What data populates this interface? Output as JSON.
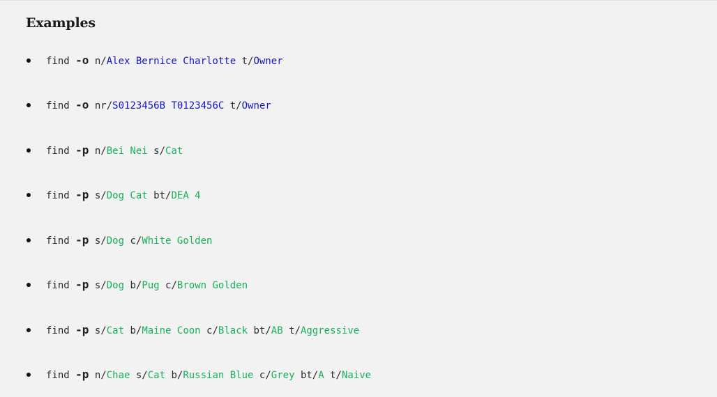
{
  "heading": "Examples",
  "examples": [
    {
      "command": "find",
      "flag": "-o",
      "params": [
        {
          "prefix": "n/",
          "value": "Alex Bernice Charlotte"
        },
        {
          "prefix": "t/",
          "value": "Owner"
        }
      ]
    },
    {
      "command": "find",
      "flag": "-o",
      "params": [
        {
          "prefix": "nr/",
          "value": "S0123456B T0123456C"
        },
        {
          "prefix": "t/",
          "value": "Owner"
        }
      ]
    },
    {
      "command": "find",
      "flag": "-p",
      "params": [
        {
          "prefix": "n/",
          "value": "Bei Nei"
        },
        {
          "prefix": "s/",
          "value": "Cat"
        }
      ]
    },
    {
      "command": "find",
      "flag": "-p",
      "params": [
        {
          "prefix": "s/",
          "value": "Dog Cat"
        },
        {
          "prefix": "bt/",
          "value": "DEA 4"
        }
      ]
    },
    {
      "command": "find",
      "flag": "-p",
      "params": [
        {
          "prefix": "s/",
          "value": "Dog"
        },
        {
          "prefix": "c/",
          "value": "White Golden"
        }
      ]
    },
    {
      "command": "find",
      "flag": "-p",
      "params": [
        {
          "prefix": "s/",
          "value": "Dog"
        },
        {
          "prefix": "b/",
          "value": "Pug"
        },
        {
          "prefix": "c/",
          "value": "Brown Golden"
        }
      ]
    },
    {
      "command": "find",
      "flag": "-p",
      "params": [
        {
          "prefix": "s/",
          "value": "Cat"
        },
        {
          "prefix": "b/",
          "value": "Maine Coon"
        },
        {
          "prefix": "c/",
          "value": "Black"
        },
        {
          "prefix": "bt/",
          "value": "AB"
        },
        {
          "prefix": "t/",
          "value": "Aggressive"
        }
      ]
    },
    {
      "command": "find",
      "flag": "-p",
      "params": [
        {
          "prefix": "n/",
          "value": "Chae"
        },
        {
          "prefix": "s/",
          "value": "Cat"
        },
        {
          "prefix": "b/",
          "value": "Russian Blue"
        },
        {
          "prefix": "c/",
          "value": "Grey"
        },
        {
          "prefix": "bt/",
          "value": "A"
        },
        {
          "prefix": "t/",
          "value": "Naive"
        }
      ]
    }
  ],
  "colors": {
    "owner_value": "#1414c8",
    "pet_value": "#18b05a",
    "text": "#2b2b2b",
    "background": "#f2f2f2"
  }
}
